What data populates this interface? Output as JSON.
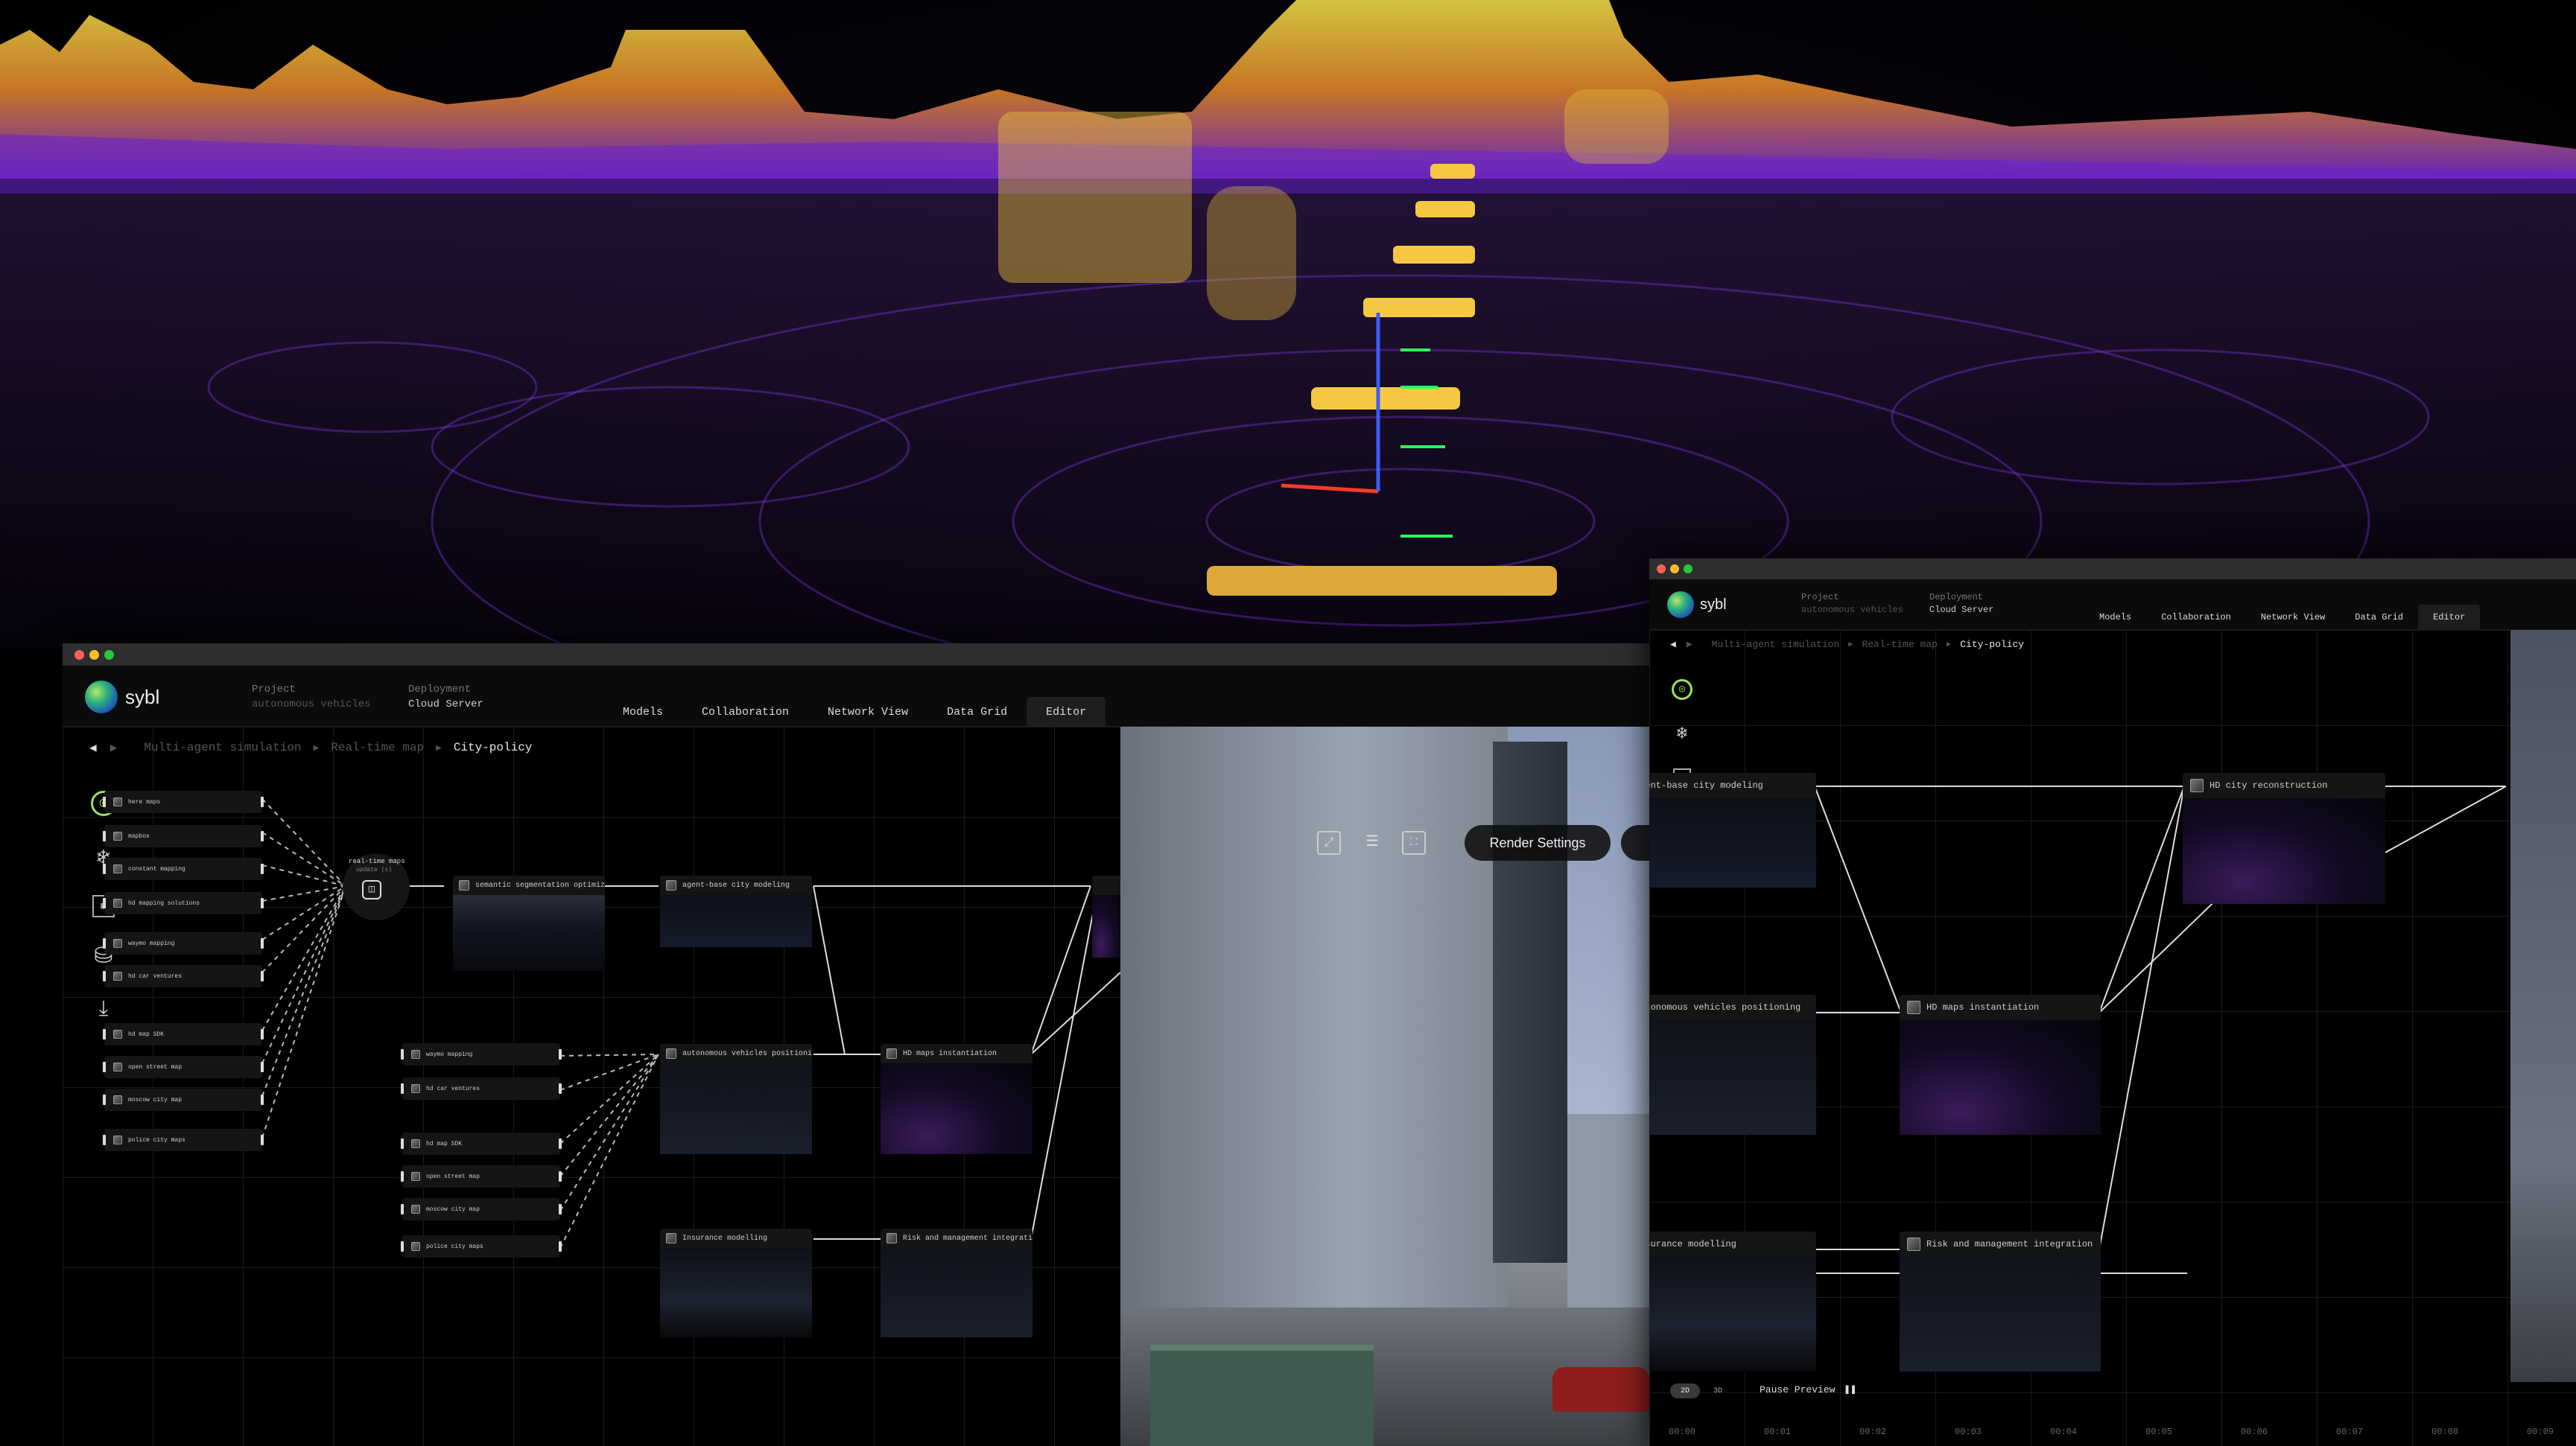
{
  "hero": {
    "description_icon": "lidar-point-cloud"
  },
  "left_window": {
    "app_name": "sybl",
    "project_label": "Project",
    "project_value": "autonomous vehicles",
    "deployment_label": "Deployment",
    "deployment_value": "Cloud Server",
    "tabs": [
      "Models",
      "Collaboration",
      "Network View",
      "Data Grid",
      "Editor"
    ],
    "active_tab": "Editor",
    "breadcrumb": [
      "Multi-agent simulation",
      "Real-time map",
      "City-policy"
    ],
    "hub": {
      "title": "real-time maps",
      "sub": "update (s)"
    },
    "source_nodes": [
      "here maps",
      "mapbox",
      "constant mapping",
      "hd mapping solutions",
      "waymo mapping",
      "hd car ventures",
      "hd map SDK",
      "open street map",
      "moscow city map",
      "police city maps"
    ],
    "source_nodes_b": [
      "waymo mapping",
      "hd car ventures",
      "hd map SDK",
      "open street map",
      "moscow city map",
      "police city maps"
    ],
    "pipeline_nodes": {
      "seg": "semantic segmentation optimization",
      "agent": "agent-base city modeling",
      "av_pos": "autonomous vehicles positioning",
      "hd_inst": "HD maps instantiation",
      "insurance": "Insurance modelling",
      "risk": "Risk and management integration"
    },
    "render_settings": "Render Settings"
  },
  "right_window": {
    "app_name": "sybl",
    "project_label": "Project",
    "project_value": "autonomous vehicles",
    "deployment_label": "Deployment",
    "deployment_value": "Cloud Server",
    "tabs": [
      "Models",
      "Collaboration",
      "Network View",
      "Data Grid",
      "Editor"
    ],
    "active_tab": "Editor",
    "breadcrumb": [
      "Multi-agent simulation",
      "Real-time map",
      "City-policy"
    ],
    "nodes": {
      "agent": "agent-base city modeling",
      "hd_city": "HD city reconstruction",
      "av_pos": "autonomous vehicles positioning",
      "hd_inst": "HD maps instantiation",
      "insurance": "Insurance modelling",
      "risk": "Risk and management integration"
    },
    "toggle_2d": "2D",
    "toggle_3d": "3D",
    "pause_preview": "Pause Preview",
    "timeline": [
      "00:00",
      "00:01",
      "00:02",
      "00:03",
      "00:04",
      "00:05",
      "00:06",
      "00:07",
      "00:08",
      "00:09"
    ]
  },
  "colors": {
    "accent_green": "#9be15d",
    "node_bg": "#151515",
    "grid": "#1b1b1b"
  }
}
